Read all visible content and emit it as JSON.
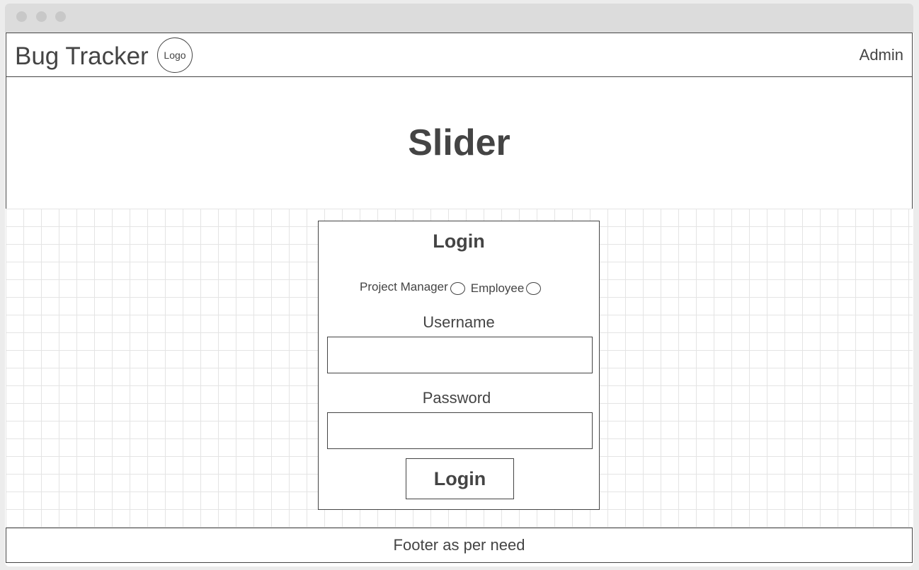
{
  "header": {
    "brand": "Bug Tracker",
    "logo": "Logo",
    "admin": "Admin"
  },
  "slider": {
    "label": "Slider"
  },
  "login": {
    "title": "Login",
    "roles": [
      "Project Manager",
      "Employee"
    ],
    "username_label": "Username",
    "username_value": "",
    "password_label": "Password",
    "password_value": "",
    "submit": "Login"
  },
  "footer": {
    "text": "Footer as per need"
  }
}
